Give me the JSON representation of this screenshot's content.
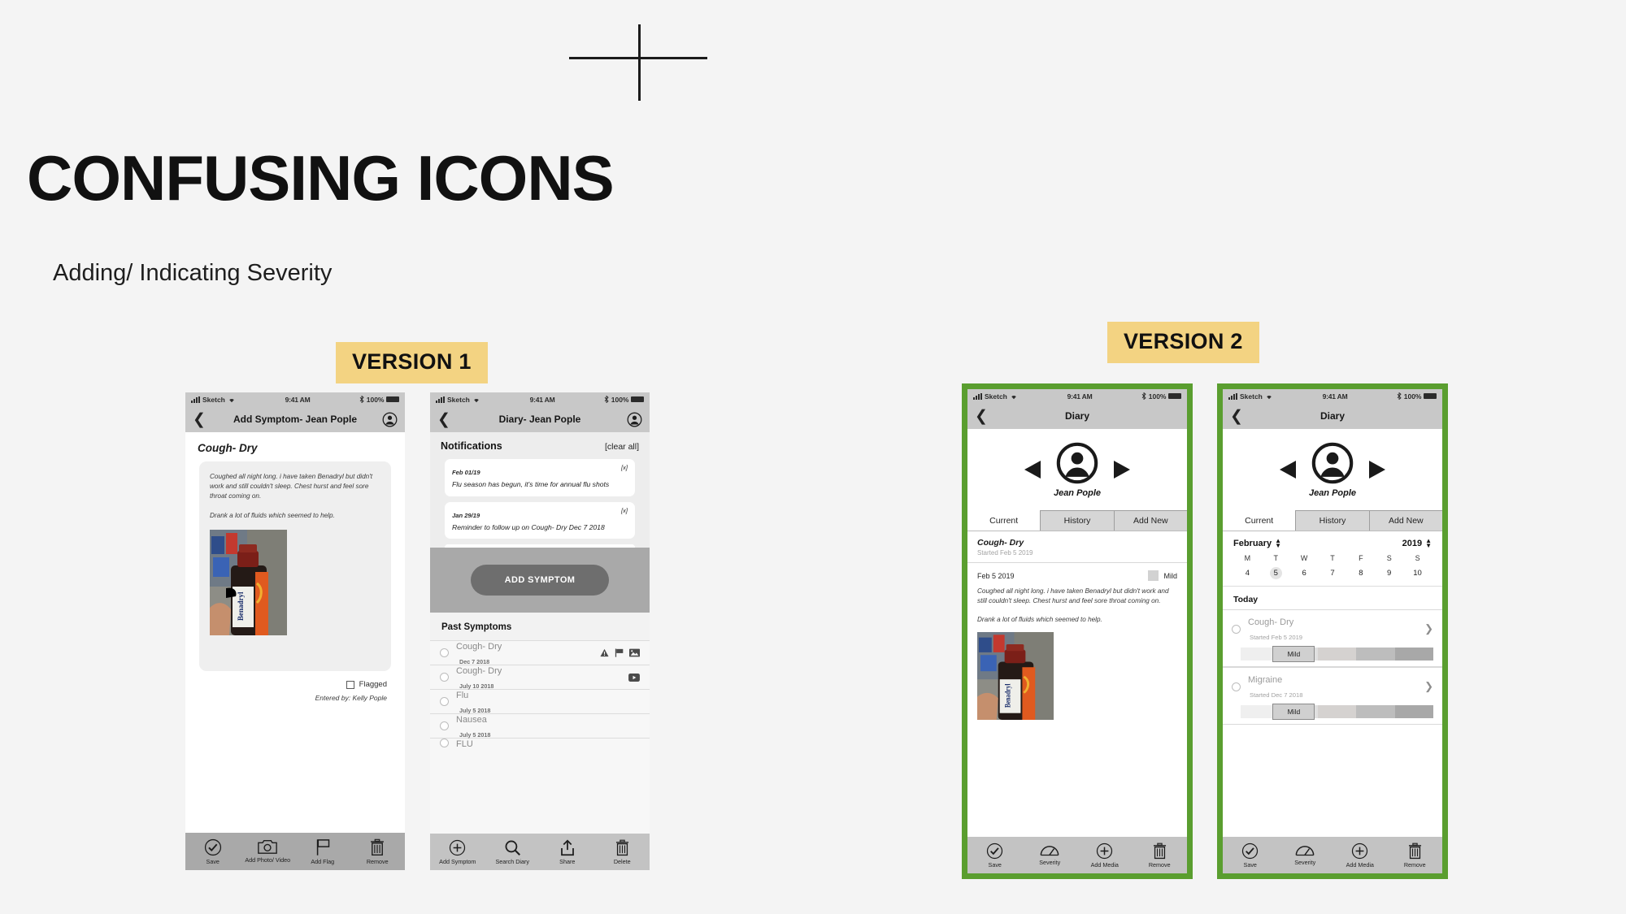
{
  "slide": {
    "title": "CONFUSING ICONS",
    "subtitle": "Adding/ Indicating Severity",
    "version1_tag": "VERSION 1",
    "version2_tag": "VERSION 2",
    "highlight_color": "#f3d382",
    "frame_color": "#5a9e2f",
    "background_color": "#f4f4f4"
  },
  "status_bar": {
    "carrier": "Sketch",
    "time": "9:41 AM",
    "battery": "100%"
  },
  "phone1": {
    "nav_title": "Add Symptom- Jean Pople",
    "heading": "Cough- Dry",
    "notes": [
      "Coughed all night long. i have taken Benadryl but didn't work and still couldn't sleep. Chest hurst and feel sore throat coming on.",
      "Drank a lot of fluids which seemed to help."
    ],
    "flag_label": "Flagged",
    "flag_checked": false,
    "entered_by": "Entered by: Kelly Pople",
    "toolbar": [
      {
        "label": "Save",
        "icon": "check-circle-icon"
      },
      {
        "label": "Add Photo/ Video",
        "icon": "camera-icon"
      },
      {
        "label": "Add Flag",
        "icon": "flag-icon"
      },
      {
        "label": "Remove",
        "icon": "trash-icon"
      }
    ]
  },
  "phone2": {
    "nav_title": "Diary- Jean Pople",
    "notifications_title": "Notifications",
    "clear_all": "[clear all]",
    "notifications": [
      {
        "date": "Feb 01/19",
        "text": "Flu season has begun, it's time for annual flu shots",
        "dismiss": "[x]"
      },
      {
        "date": "Jan 29/19",
        "text": "Reminder to follow up on Cough- Dry Dec 7 2018",
        "dismiss": "[x]"
      }
    ],
    "add_symptom_button": "ADD SYMPTOM",
    "past_symptoms_title": "Past Symptoms",
    "past_symptoms": [
      {
        "name": "Cough- Dry",
        "date": "Dec 7 2018",
        "icons": [
          "warning-icon",
          "flag-icon",
          "image-icon"
        ]
      },
      {
        "name": "Cough- Dry",
        "date": "July 10 2018",
        "icons": [
          "video-icon"
        ]
      },
      {
        "name": "Flu",
        "date": "July 5 2018",
        "icons": []
      },
      {
        "name": "Nausea",
        "date": "July 5 2018",
        "icons": []
      },
      {
        "name": "FLU",
        "date": "",
        "icons": []
      }
    ],
    "toolbar": [
      {
        "label": "Add Symptom",
        "icon": "plus-circle-icon"
      },
      {
        "label": "Search Diary",
        "icon": "search-icon"
      },
      {
        "label": "Share",
        "icon": "share-icon"
      },
      {
        "label": "Delete",
        "icon": "trash-icon"
      }
    ]
  },
  "phone3": {
    "nav_title": "Diary",
    "patient_name": "Jean Pople",
    "tabs": [
      {
        "label": "Current",
        "active": true
      },
      {
        "label": "History",
        "active": false
      },
      {
        "label": "Add New",
        "active": false
      }
    ],
    "symptom_title": "Cough- Dry",
    "symptom_started": "Started Feb 5 2019",
    "entry_date": "Feb 5 2019",
    "entry_severity": "Mild",
    "notes": [
      "Coughed all night long. i have taken Benadryl but didn't work and still couldn't sleep. Chest hurst and feel sore throat coming on.",
      "Drank a lot of fluids which seemed to help."
    ],
    "toolbar": [
      {
        "label": "Save",
        "icon": "check-circle-icon"
      },
      {
        "label": "Severity",
        "icon": "gauge-icon"
      },
      {
        "label": "Add Media",
        "icon": "plus-circle-icon"
      },
      {
        "label": "Remove",
        "icon": "trash-icon"
      }
    ]
  },
  "phone4": {
    "nav_title": "Diary",
    "patient_name": "Jean Pople",
    "tabs": [
      {
        "label": "Current",
        "active": true
      },
      {
        "label": "History",
        "active": false
      },
      {
        "label": "Add New",
        "active": false
      }
    ],
    "calendar": {
      "month": "February",
      "year": "2019",
      "day_initials": [
        "M",
        "T",
        "W",
        "T",
        "F",
        "S",
        "S"
      ],
      "days": [
        "4",
        "5",
        "6",
        "7",
        "8",
        "9",
        "10"
      ],
      "selected_day": "5"
    },
    "today_label": "Today",
    "items": [
      {
        "name": "Cough- Dry",
        "sub": "Started Feb 5 2019",
        "severity": "Mild"
      },
      {
        "name": "Migraine",
        "sub": "Started Dec 7 2018",
        "severity": "Mild"
      }
    ],
    "toolbar": [
      {
        "label": "Save",
        "icon": "check-circle-icon"
      },
      {
        "label": "Severity",
        "icon": "gauge-icon"
      },
      {
        "label": "Add Media",
        "icon": "plus-circle-icon"
      },
      {
        "label": "Remove",
        "icon": "trash-icon"
      }
    ]
  }
}
